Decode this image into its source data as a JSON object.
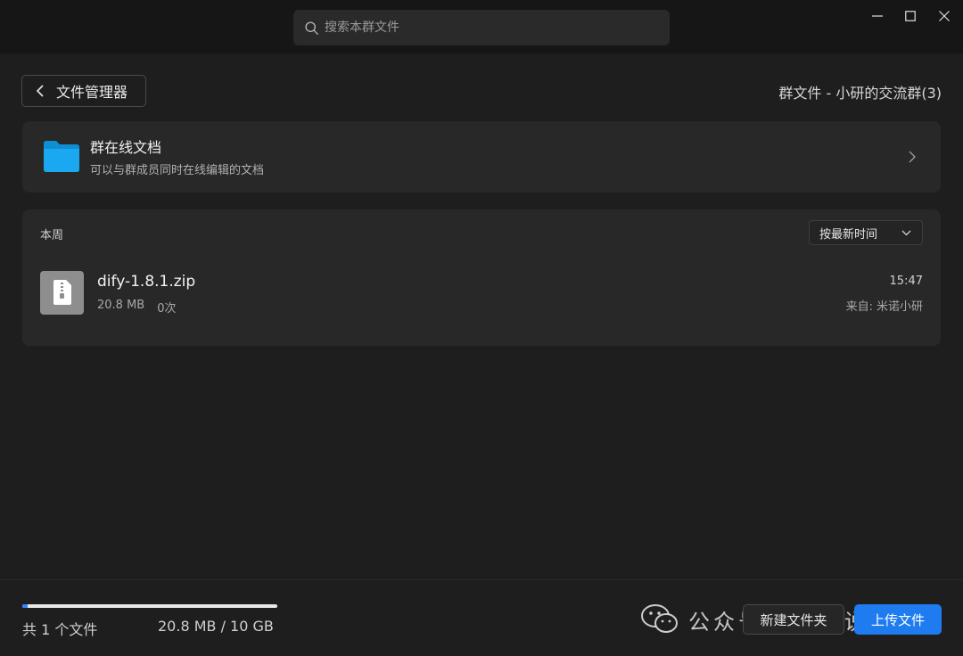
{
  "search": {
    "placeholder": "搜索本群文件"
  },
  "header": {
    "back_label": "文件管理器",
    "title": "群文件 - 小研的交流群(3)"
  },
  "online_docs": {
    "title": "群在线文档",
    "subtitle": "可以与群成员同时在线编辑的文档"
  },
  "file_list": {
    "section_label": "本周",
    "sort_label": "按最新时间",
    "files": [
      {
        "name": "dify-1.8.1.zip",
        "size": "20.8 MB",
        "downloads": "0次",
        "time": "15:47",
        "source_label": "来自:",
        "source_name": "米诺小研"
      }
    ]
  },
  "footer": {
    "file_count": "共 1 个文件",
    "storage": "20.8 MB / 10 GB",
    "storage_used_fraction": 0.002,
    "new_folder_label": "新建文件夹",
    "upload_label": "上传文件"
  },
  "watermark": {
    "text": "公众号 · 小研说技术"
  },
  "colors": {
    "accent": "#1f7cf0",
    "folder": "#1aa8f0",
    "background": "#1e1e1e",
    "card": "#282828"
  }
}
